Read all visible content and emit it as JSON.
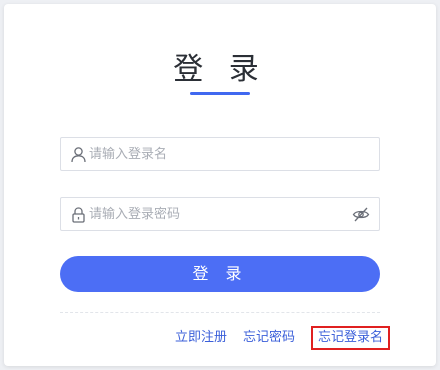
{
  "title": "登 录",
  "username": {
    "placeholder": "请输入登录名",
    "icon": "user-icon"
  },
  "password": {
    "placeholder": "请输入登录密码",
    "icon": "lock-icon",
    "toggle_icon": "eye-hidden-icon"
  },
  "login_button": "登 录",
  "links": {
    "register": "立即注册",
    "forgot_password": "忘记密码",
    "forgot_username": "忘记登录名"
  },
  "colors": {
    "accent": "#4c6ef5",
    "link": "#3b5fd9",
    "highlight_border": "#e02020"
  }
}
